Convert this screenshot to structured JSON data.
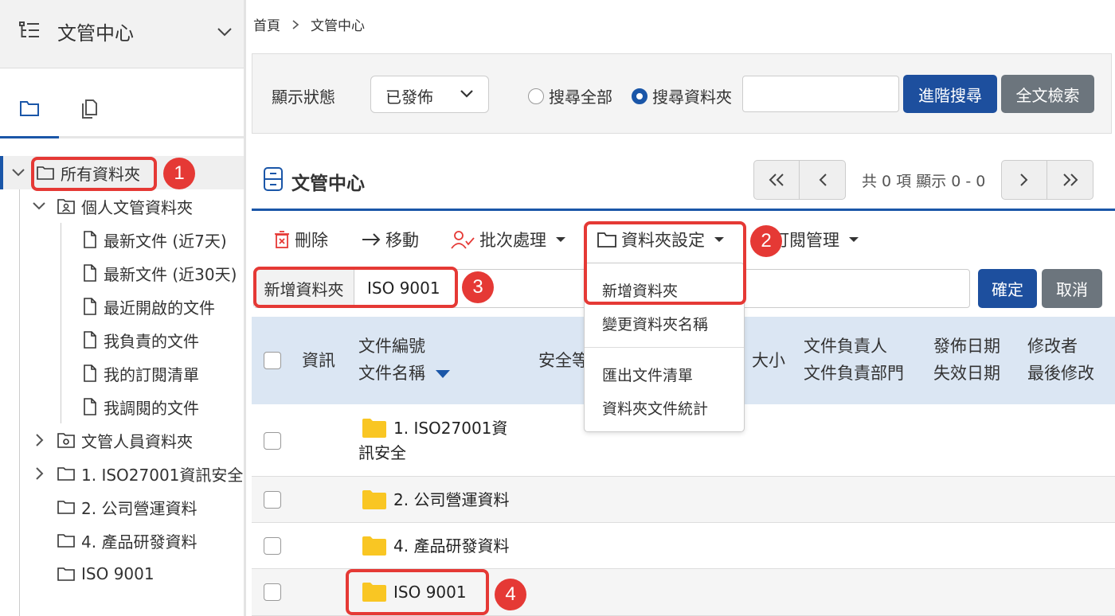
{
  "sidebar": {
    "title": "文管中心",
    "tabs": [
      "folder-tab",
      "documents-tab"
    ],
    "tree": {
      "root": "所有資料夾",
      "personal": "個人文管資料夾",
      "personal_items": [
        "最新文件 (近7天)",
        "最新文件 (近30天)",
        "最近開啟的文件",
        "我負責的文件",
        "我的訂閱清單",
        "我調閱的文件"
      ],
      "staff": "文管人員資料夾",
      "folders": [
        "1. ISO27001資訊安全",
        "2. 公司營運資料",
        "4. 產品研發資料",
        "ISO 9001"
      ]
    }
  },
  "breadcrumb": [
    "首頁",
    "文管中心"
  ],
  "search": {
    "status_label": "顯示狀態",
    "status_value": "已發佈",
    "radio_all": "搜尋全部",
    "radio_folder": "搜尋資料夾",
    "advanced_button": "進階搜尋",
    "fulltext_button": "全文檢索"
  },
  "section": {
    "title": "文管中心",
    "pager_text": "共 0 項 顯示 0 - 0"
  },
  "toolbar": {
    "delete": "刪除",
    "move": "移動",
    "batch": "批次處理",
    "folder_settings": "資料夾設定",
    "subscription": "訂閱管理"
  },
  "dropdown": {
    "items": [
      "新增資料夾",
      "變更資料夾名稱",
      "匯出文件清單",
      "資料夾文件統計"
    ]
  },
  "new_folder": {
    "label": "新增資料夾",
    "value": "ISO 9001",
    "confirm": "確定",
    "cancel": "取消"
  },
  "table": {
    "headers": {
      "info": "資訊",
      "doc_no": "文件編號",
      "doc_name": "文件名稱",
      "security": "安全等",
      "size": "大小",
      "owner": "文件負責人",
      "owner_dept": "文件負責部門",
      "publish_date": "發佈日期",
      "expire_date": "失效日期",
      "modifier": "修改者",
      "last_modified": "最後修改"
    },
    "rows": [
      {
        "name_line1": "1. ISO27001資",
        "name_line2": "訊安全"
      },
      {
        "name_line1": "2. 公司營運資料"
      },
      {
        "name_line1": "4. 產品研發資料"
      },
      {
        "name_line1": "ISO 9001"
      }
    ]
  },
  "annotations": [
    "1",
    "2",
    "3",
    "4"
  ],
  "colors": {
    "accent": "#1d4f9e",
    "highlight": "#e53935",
    "folder": "#f9c623",
    "header_bg": "#dbe6f3"
  }
}
